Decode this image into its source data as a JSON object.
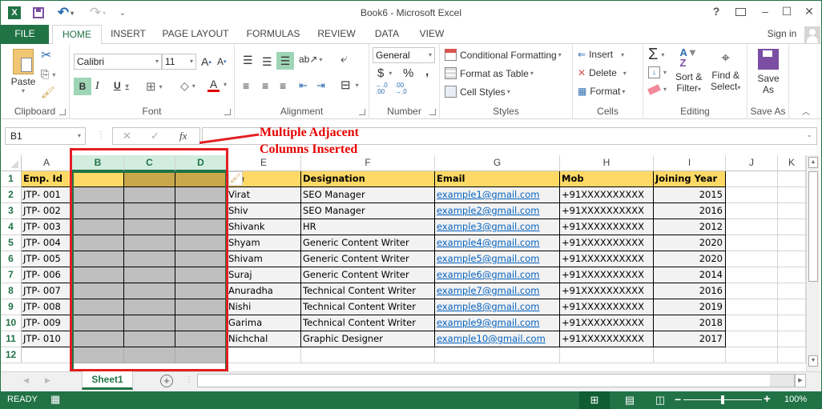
{
  "window": {
    "title": "Book6 - Microsoft Excel",
    "controls": {
      "help": "?",
      "ribbon_display": "⊼",
      "minimize": "–",
      "maximize": "☐",
      "close": "✕"
    }
  },
  "quick_access": {
    "app_icon": "X",
    "save": "save-icon",
    "undo": "↶",
    "redo": "↷",
    "customize": "⌄"
  },
  "tabs": [
    "FILE",
    "HOME",
    "INSERT",
    "PAGE LAYOUT",
    "FORMULAS",
    "REVIEW",
    "DATA",
    "VIEW"
  ],
  "active_tab": "HOME",
  "sign_in": "Sign in",
  "ribbon": {
    "clipboard": {
      "label": "Clipboard",
      "paste": "Paste"
    },
    "font": {
      "label": "Font",
      "font_name": "Calibri",
      "font_size": "11",
      "bold": "B",
      "italic": "I",
      "underline": "U",
      "grow": "A",
      "shrink": "A",
      "font_color": "#e00000"
    },
    "alignment": {
      "label": "Alignment"
    },
    "number": {
      "label": "Number",
      "format": "General",
      "currency": "$",
      "percent": "%",
      "comma": ",",
      "inc_decimal": "←.0 .00",
      "dec_decimal": ".00 →.0"
    },
    "styles": {
      "label": "Styles",
      "conditional": "Conditional Formatting",
      "format_table": "Format as Table",
      "cell_styles": "Cell Styles"
    },
    "cells": {
      "label": "Cells",
      "insert": "Insert",
      "delete": "Delete",
      "format": "Format"
    },
    "editing": {
      "label": "Editing",
      "autosum": "Σ",
      "sort_filter_1": "Sort &",
      "sort_filter_2": "Filter",
      "find_select_1": "Find &",
      "find_select_2": "Select"
    },
    "save_as": {
      "label": "Save As",
      "button_1": "Save",
      "button_2": "As"
    }
  },
  "formula_bar": {
    "name_box": "B1",
    "cancel": "✕",
    "enter": "✓",
    "fx": "fx",
    "value": ""
  },
  "annotation": {
    "line1": "Multiple Adjacent",
    "line2": "Columns Inserted"
  },
  "columns": [
    "A",
    "B",
    "C",
    "D",
    "E",
    "F",
    "G",
    "H",
    "I",
    "J",
    "K"
  ],
  "selected_columns": [
    "B",
    "C",
    "D"
  ],
  "rows": [
    "1",
    "2",
    "3",
    "4",
    "5",
    "6",
    "7",
    "8",
    "9",
    "10",
    "11",
    "12"
  ],
  "table": {
    "headers": {
      "A": "Emp. Id",
      "E": "Name",
      "F": "Designation",
      "G": "Email",
      "H": "Mob",
      "I": "Joining Year"
    },
    "header_visible_E": "me",
    "records": [
      {
        "id": "JTP- 001",
        "name": "Virat",
        "designation": "SEO Manager",
        "email": "example1@gmail.com",
        "mob": "+91XXXXXXXXXX",
        "year": "2015"
      },
      {
        "id": "JTP- 002",
        "name": "Shiv",
        "designation": "SEO Manager",
        "email": "example2@gmail.com",
        "mob": "+91XXXXXXXXXX",
        "year": "2016"
      },
      {
        "id": "JTP- 003",
        "name": "Shivank",
        "designation": "HR",
        "email": "example3@gmail.com",
        "mob": "+91XXXXXXXXXX",
        "year": "2012"
      },
      {
        "id": "JTP- 004",
        "name": "Shyam",
        "designation": "Generic Content Writer",
        "email": "example4@gmail.com",
        "mob": "+91XXXXXXXXXX",
        "year": "2020"
      },
      {
        "id": "JTP- 005",
        "name": "Shivam",
        "designation": "Generic Content Writer",
        "email": "example5@gmail.com",
        "mob": "+91XXXXXXXXXX",
        "year": "2020"
      },
      {
        "id": "JTP- 006",
        "name": "Suraj",
        "designation": "Generic Content Writer",
        "email": "example6@gmail.com",
        "mob": "+91XXXXXXXXXX",
        "year": "2014"
      },
      {
        "id": "JTP- 007",
        "name": "Anuradha",
        "designation": "Technical Content Writer",
        "email": "example7@gmail.com",
        "mob": "+91XXXXXXXXXX",
        "year": "2016"
      },
      {
        "id": "JTP- 008",
        "name": "Nishi",
        "designation": "Technical Content Writer",
        "email": "example8@gmail.com",
        "mob": "+91XXXXXXXXXX",
        "year": "2019"
      },
      {
        "id": "JTP- 009",
        "name": "Garima",
        "designation": "Technical Content Writer",
        "email": "example9@gmail.com",
        "mob": "+91XXXXXXXXXX",
        "year": "2018"
      },
      {
        "id": "JTP- 010",
        "name": "Nichchal",
        "designation": "Graphic Designer",
        "email": "example10@gmail.com",
        "mob": "+91XXXXXXXXXX",
        "year": "2017"
      }
    ]
  },
  "sheets": [
    "Sheet1"
  ],
  "active_sheet": "Sheet1",
  "status": {
    "mode": "READY",
    "zoom": "100%",
    "zoom_level_percent": 100
  }
}
